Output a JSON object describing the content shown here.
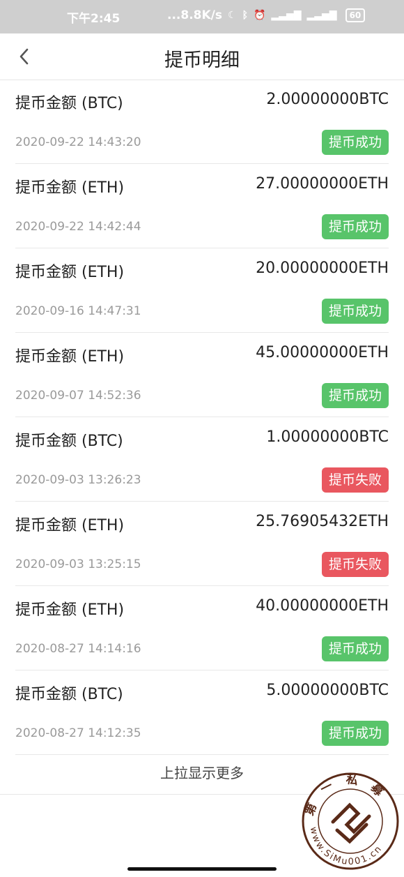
{
  "status_bar": {
    "time": "下午2:45",
    "network_speed": "...8.8K/s",
    "battery": "60"
  },
  "header": {
    "title": "提币明细",
    "back_icon": "chevron-left-icon"
  },
  "records": [
    {
      "label": "提币金额 (BTC)",
      "amount": "2.00000000BTC",
      "date": "2020-09-22 14:43:20",
      "status": "提币成功"
    },
    {
      "label": "提币金额 (ETH)",
      "amount": "27.00000000ETH",
      "date": "2020-09-22 14:42:44",
      "status": "提币成功"
    },
    {
      "label": "提币金额 (ETH)",
      "amount": "20.00000000ETH",
      "date": "2020-09-16 14:47:31",
      "status": "提币成功"
    },
    {
      "label": "提币金额 (ETH)",
      "amount": "45.00000000ETH",
      "date": "2020-09-07 14:52:36",
      "status": "提币成功"
    },
    {
      "label": "提币金额 (BTC)",
      "amount": "1.00000000BTC",
      "date": "2020-09-03 13:26:23",
      "status": "提币失败"
    },
    {
      "label": "提币金额 (ETH)",
      "amount": "25.76905432ETH",
      "date": "2020-09-03 13:25:15",
      "status": "提币失败"
    },
    {
      "label": "提币金额 (ETH)",
      "amount": "40.00000000ETH",
      "date": "2020-08-27 14:14:16",
      "status": "提币成功"
    },
    {
      "label": "提币金额 (BTC)",
      "amount": "5.00000000BTC",
      "date": "2020-08-27 14:12:35",
      "status": "提币成功"
    }
  ],
  "load_more": "上拉显示更多",
  "watermark": {
    "top_text": "第一私募",
    "bottom_text": "www.SiMu001.cn"
  },
  "colors": {
    "success": "#58c46a",
    "fail": "#e9575f",
    "status_bar": "#cfcfcf"
  }
}
